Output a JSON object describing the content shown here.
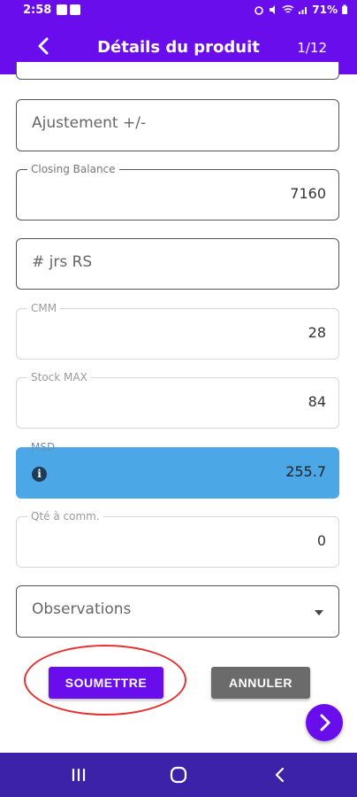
{
  "status_bar": {
    "time": "2:58",
    "battery": "71%"
  },
  "app_bar": {
    "title": "Détails du produit",
    "page_indicator": "1/12"
  },
  "form": {
    "ajustement": {
      "placeholder": "Ajustement +/-"
    },
    "closing_balance": {
      "label": "Closing Balance",
      "value": "7160"
    },
    "jrs_rs": {
      "placeholder": "# jrs RS"
    },
    "cmm": {
      "label": "CMM",
      "value": "28"
    },
    "stock_max": {
      "label": "Stock MAX",
      "value": "84"
    },
    "msd": {
      "label": "MSD",
      "value": "255.7"
    },
    "qte_comm": {
      "label": "Qté à comm.",
      "value": "0"
    },
    "observations": {
      "placeholder": "Observations"
    }
  },
  "actions": {
    "submit_label": "SOUMETTRE",
    "cancel_label": "ANNULER"
  },
  "colors": {
    "primary": "#6a0dec",
    "nav_bar": "#3b22a8",
    "highlight": "#4ca7e6",
    "secondary_button": "#6b6b6b",
    "annotation_circle": "#e53030"
  },
  "icons": {
    "back": "arrow-left-icon",
    "info": "info-icon",
    "next": "chevron-right-icon",
    "dropdown": "dropdown-arrow-icon"
  }
}
